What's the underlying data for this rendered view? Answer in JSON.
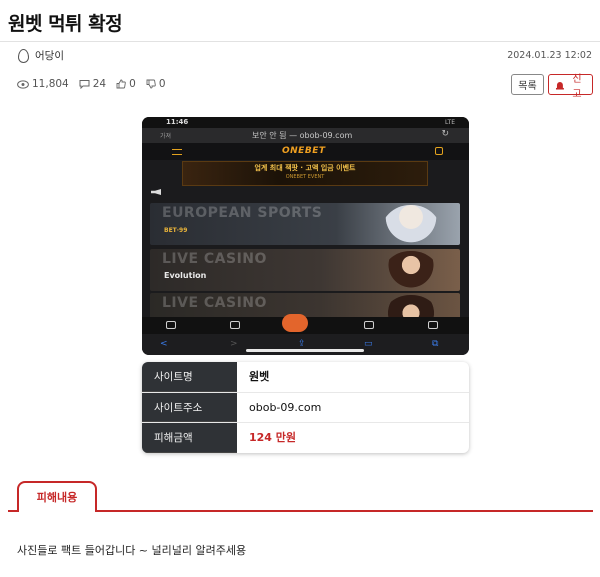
{
  "post": {
    "title": "원벳 먹튀 확정",
    "author": "어당이",
    "date": "2024.01.23 12:02",
    "views": "11,804",
    "comments": "24",
    "likes": "0",
    "dislikes": "0"
  },
  "buttons": {
    "list_label": "목록",
    "report_label": "신고"
  },
  "screenshot": {
    "status_time": "11:46",
    "status_signal": "LTE",
    "url_left": "가져",
    "url_text": "보안 안 됨 — obob-09.com",
    "site_logo": "ONEBET",
    "promo_text": "업계 최대 잭팟 · 고액 입금 이벤트",
    "promo_sub": "ONEBET EVENT",
    "banners": [
      {
        "title": "EUROPEAN SPORTS",
        "sub": "BET·99"
      },
      {
        "title": "LIVE CASINO",
        "sub": "Evolution"
      },
      {
        "title": "LIVE CASINO",
        "sub": ""
      }
    ]
  },
  "info_table": {
    "rows": [
      {
        "key": "사이트명",
        "value": "원벳"
      },
      {
        "key": "사이트주소",
        "value": "obob-09.com"
      },
      {
        "key": "피해금액",
        "value": "124 만원"
      }
    ]
  },
  "tab": {
    "label": "피해내용"
  },
  "content": {
    "text": "사진들로 팩트 들어갑니다 ~ 널리널리 알려주세용"
  },
  "colors": {
    "accent": "#c62828",
    "table_key_bg": "#2f3236"
  }
}
